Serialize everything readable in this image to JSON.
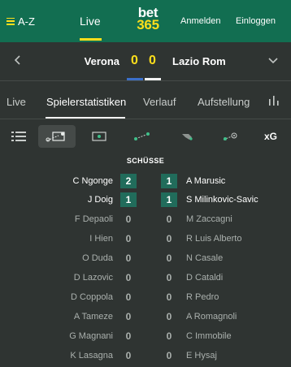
{
  "header": {
    "menu_label": "A-Z",
    "live_label": "Live",
    "logo_top": "bet",
    "logo_bottom": "365",
    "signup_label": "Anmelden",
    "login_label": "Einloggen"
  },
  "match": {
    "home_team": "Verona",
    "away_team": "Lazio Rom",
    "home_score": "0",
    "away_score": "0"
  },
  "tabs": [
    {
      "label": "Live"
    },
    {
      "label": "Spielerstatistiken"
    },
    {
      "label": "Verlauf"
    },
    {
      "label": "Aufstellung"
    }
  ],
  "stat_categories": {
    "icons": [
      "grid-icon",
      "shots-icon",
      "goal-frame-icon",
      "pass-icon",
      "tackle-icon",
      "dribble-icon"
    ],
    "xg_label": "xG",
    "active_index": 1
  },
  "section": {
    "title": "SCHÜSSE"
  },
  "colors": {
    "header_bg": "#126e51",
    "accent": "#ffdf1b",
    "highlight_cell": "#216c5b",
    "home_bar": "#3b6fc9",
    "away_bar": "#f2f2f2"
  },
  "rows": [
    {
      "home_player": "C Ngonge",
      "home_value": "2",
      "away_value": "1",
      "away_player": "A Marusic",
      "home_hl": true,
      "away_hl": true
    },
    {
      "home_player": "J Doig",
      "home_value": "1",
      "away_value": "1",
      "away_player": "S Milinkovic-Savic",
      "home_hl": true,
      "away_hl": true
    },
    {
      "home_player": "F Depaoli",
      "home_value": "0",
      "away_value": "0",
      "away_player": "M Zaccagni",
      "home_hl": false,
      "away_hl": false
    },
    {
      "home_player": "I Hien",
      "home_value": "0",
      "away_value": "0",
      "away_player": "R Luis Alberto",
      "home_hl": false,
      "away_hl": false
    },
    {
      "home_player": "O Duda",
      "home_value": "0",
      "away_value": "0",
      "away_player": "N Casale",
      "home_hl": false,
      "away_hl": false
    },
    {
      "home_player": "D Lazovic",
      "home_value": "0",
      "away_value": "0",
      "away_player": "D Cataldi",
      "home_hl": false,
      "away_hl": false
    },
    {
      "home_player": "D Coppola",
      "home_value": "0",
      "away_value": "0",
      "away_player": "R Pedro",
      "home_hl": false,
      "away_hl": false
    },
    {
      "home_player": "A Tameze",
      "home_value": "0",
      "away_value": "0",
      "away_player": "A Romagnoli",
      "home_hl": false,
      "away_hl": false
    },
    {
      "home_player": "G Magnani",
      "home_value": "0",
      "away_value": "0",
      "away_player": "C Immobile",
      "home_hl": false,
      "away_hl": false
    },
    {
      "home_player": "K Lasagna",
      "home_value": "0",
      "away_value": "0",
      "away_player": "E Hysaj",
      "home_hl": false,
      "away_hl": false
    }
  ]
}
